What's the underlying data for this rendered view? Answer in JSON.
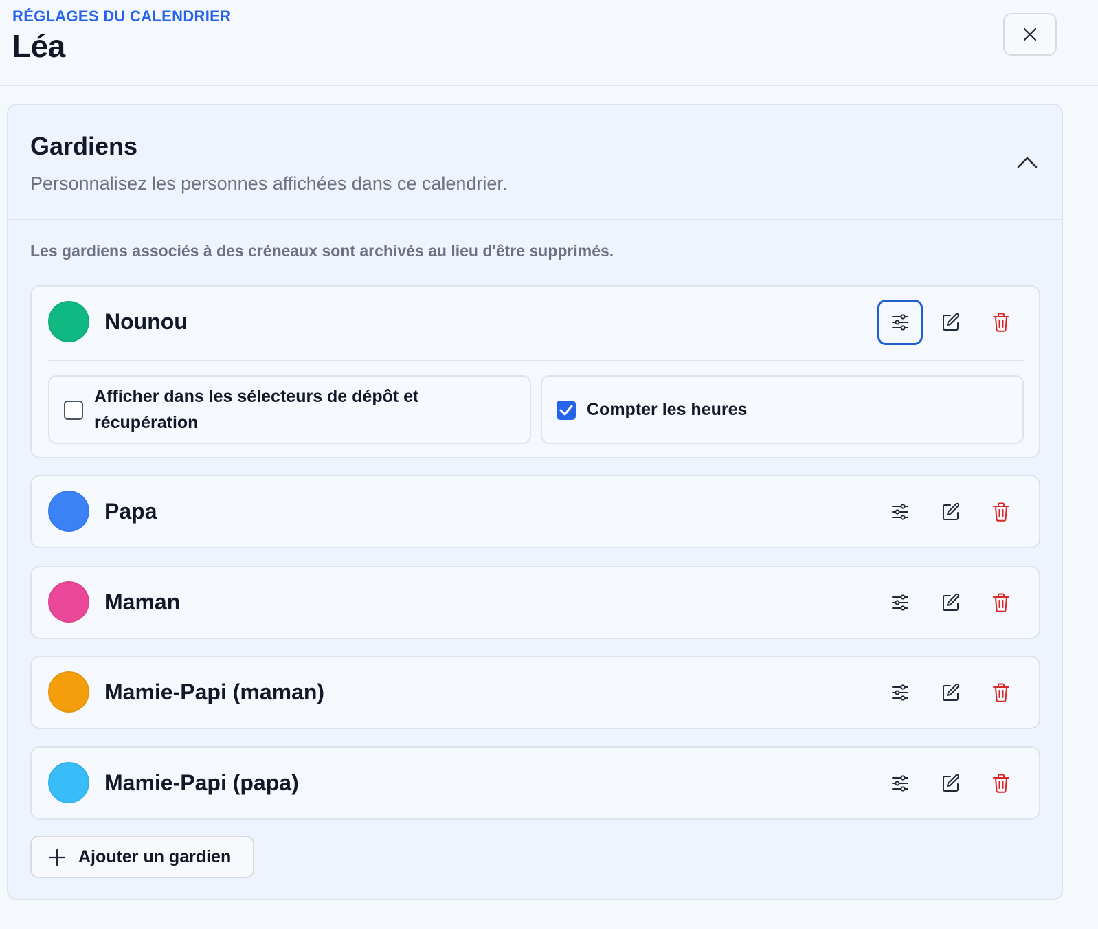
{
  "header": {
    "eyebrow": "RÉGLAGES DU CALENDRIER",
    "title": "Léa",
    "close_icon": "close-icon"
  },
  "section": {
    "title": "Gardiens",
    "subtitle": "Personnalisez les personnes affichées dans ce calendrier.",
    "toggle_icon": "chevron-up-icon",
    "note": "Les gardiens associés à des créneaux sont archivés au lieu d'être supprimés."
  },
  "guardians": [
    {
      "name": "Nounou",
      "color": "#10b981",
      "expanded": true,
      "options": [
        {
          "label": "Afficher dans les sélecteurs de dépôt et récupération",
          "checked": false
        },
        {
          "label": "Compter les heures",
          "checked": true
        }
      ]
    },
    {
      "name": "Papa",
      "color": "#3b82f6",
      "expanded": false
    },
    {
      "name": "Maman",
      "color": "#ec4899",
      "expanded": false
    },
    {
      "name": "Mamie-Papi (maman)",
      "color": "#f59e0b",
      "expanded": false
    },
    {
      "name": "Mamie-Papi (papa)",
      "color": "#38bdf8",
      "expanded": false
    }
  ],
  "actions": {
    "settings_icon": "sliders-icon",
    "edit_icon": "pencil-icon",
    "delete_icon": "trash-icon"
  },
  "add_button": {
    "label": "Ajouter un gardien",
    "icon": "plus-icon"
  },
  "colors": {
    "accent": "#2563eb",
    "delete": "#dc2626",
    "focus": "#1d5fd1"
  }
}
